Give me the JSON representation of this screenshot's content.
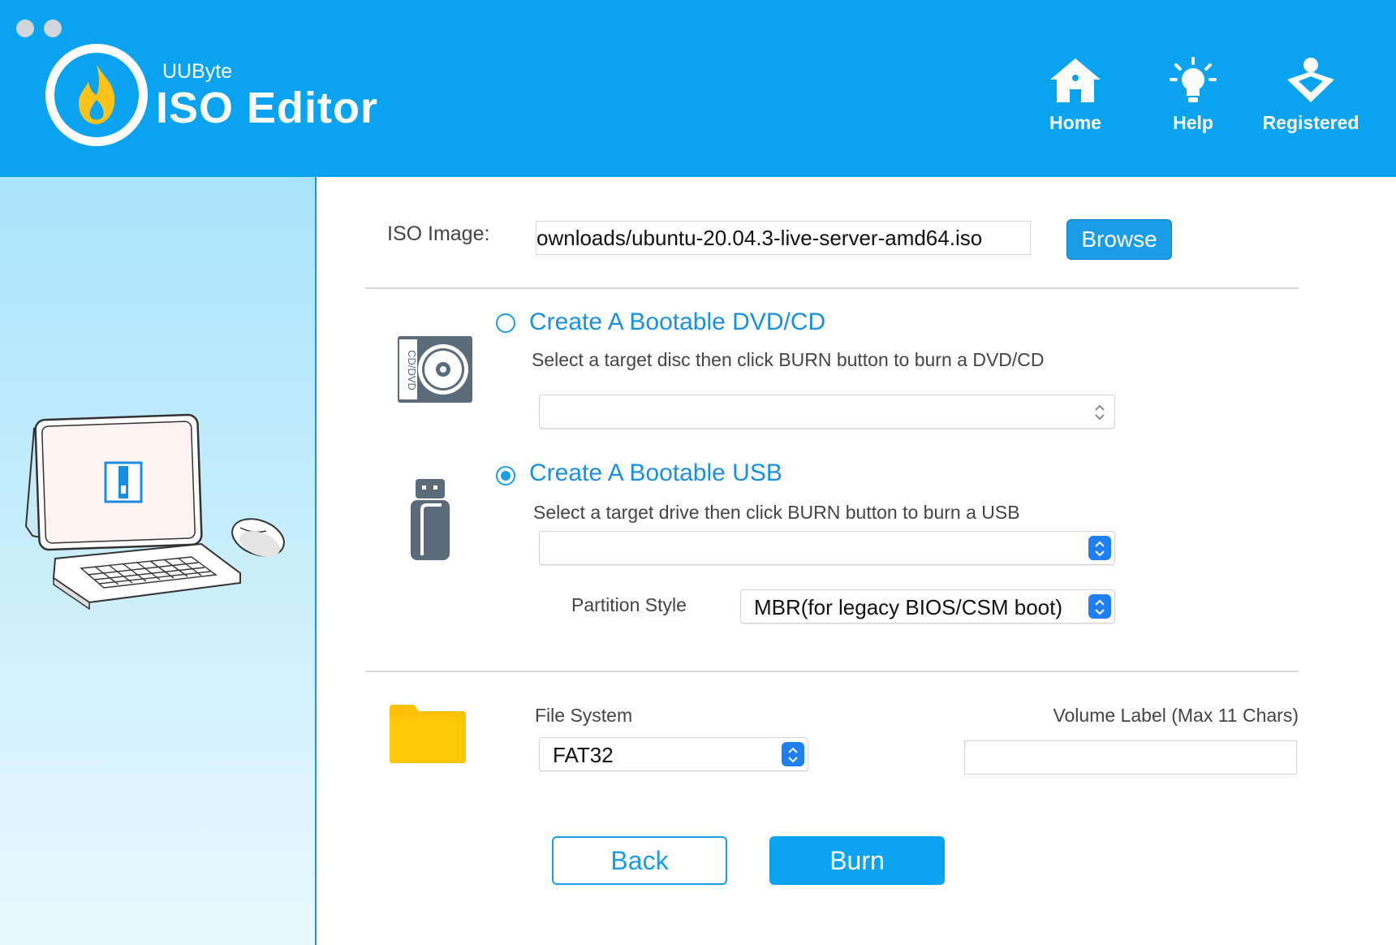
{
  "window": {
    "brand_small": "UUByte",
    "brand_big": "ISO Editor"
  },
  "nav": {
    "home": "Home",
    "help": "Help",
    "registered": "Registered"
  },
  "iso": {
    "label": "ISO Image:",
    "value": "ownloads/ubuntu-20.04.3-live-server-amd64.iso",
    "browse": "Browse"
  },
  "dvd": {
    "title": "Create A Bootable DVD/CD",
    "description": "Select a target disc then click BURN button to burn a DVD/CD",
    "icon_text": "CD/DVD",
    "selected": false,
    "selected_value": ""
  },
  "usb": {
    "title": "Create A Bootable USB",
    "description": "Select a target drive then click BURN button to burn a USB",
    "selected": true,
    "selected_value": ""
  },
  "partition": {
    "label": "Partition Style",
    "value": "MBR(for legacy BIOS/CSM boot)"
  },
  "filesystem": {
    "label": "File System",
    "value": "FAT32"
  },
  "volume": {
    "label": "Volume Label (Max 11 Chars)",
    "value": ""
  },
  "actions": {
    "back": "Back",
    "burn": "Burn"
  },
  "colors": {
    "brand_blue": "#0aa3f0",
    "accent_blue": "#1a9ce6",
    "folder_yellow": "#ffc107"
  }
}
